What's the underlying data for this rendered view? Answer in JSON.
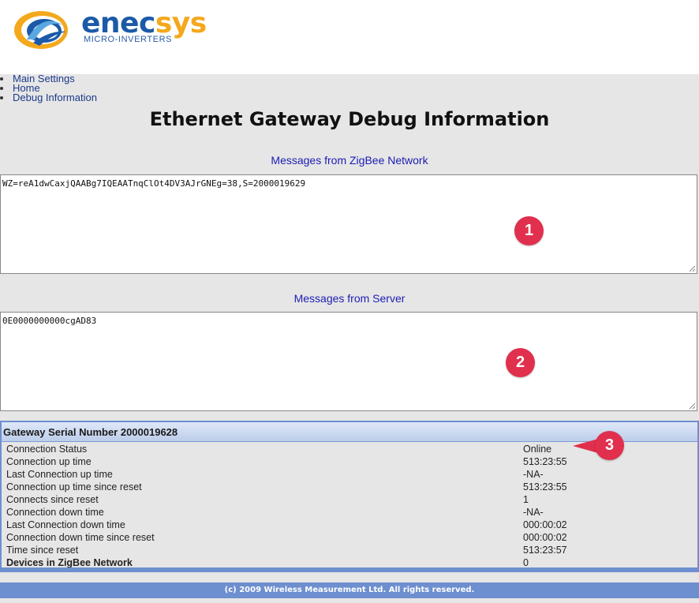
{
  "brand": {
    "name_part1": "enec",
    "name_part2": "sys",
    "tagline": "MICRO-INVERTERS"
  },
  "nav": [
    {
      "label": "Main Settings"
    },
    {
      "label": "Home"
    },
    {
      "label": "Debug Information"
    }
  ],
  "page_title": "Ethernet Gateway Debug Information",
  "zigbee": {
    "label": "Messages from ZigBee Network",
    "text": "WZ=reA1dwCaxjQAABg7IQEAATnqClOt4DV3AJrGNEg=38,S=2000019629"
  },
  "server": {
    "label": "Messages from Server",
    "text": "0E0000000000cgAD83"
  },
  "badges": {
    "one": "1",
    "two": "2",
    "three": "3"
  },
  "status": {
    "title": "Gateway Serial Number 2000019628",
    "rows": [
      {
        "key": "Connection Status",
        "value": "Online"
      },
      {
        "key": "Connection up time",
        "value": "513:23:55"
      },
      {
        "key": "Last Connection up time",
        "value": "-NA-"
      },
      {
        "key": "Connection up time since reset",
        "value": "513:23:55"
      },
      {
        "key": "Connects since reset",
        "value": "1"
      },
      {
        "key": "Connection down time",
        "value": "-NA-"
      },
      {
        "key": "Last Connection down time",
        "value": "000:00:02"
      },
      {
        "key": "Connection down time since reset",
        "value": "000:00:02"
      },
      {
        "key": "Time since reset",
        "value": "513:23:57"
      },
      {
        "key": "Devices in ZigBee Network",
        "value": "0"
      }
    ]
  },
  "footer": "(c) 2009 Wireless Measurement Ltd. All rights reserved.",
  "colors": {
    "brand_blue": "#1b5aa8",
    "brand_orange": "#f4a81c",
    "link": "#1c1cb4",
    "panel_border": "#6e8fcf",
    "badge": "#e0304d"
  }
}
